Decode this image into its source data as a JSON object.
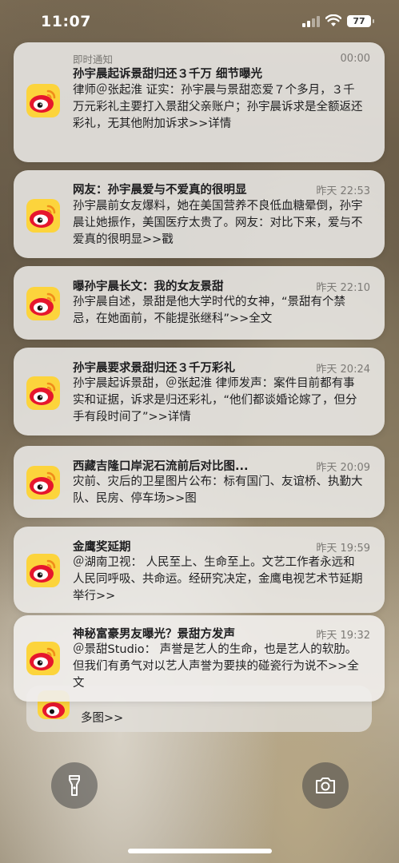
{
  "status_bar": {
    "time": "11:07",
    "battery": "77"
  },
  "instant_label": "即时通知",
  "notifications": [
    {
      "title": "孙宇晨起诉景甜归还３千万 细节曝光",
      "time": "00:00",
      "body": "律师＠张起淮 证实：孙宇晨与景甜恋爱７个多月，３千万元彩礼主要打入景甜父亲账户；孙宇晨诉求是全额返还彩礼，无其他附加诉求>>详情"
    },
    {
      "title": "网友：孙宇晨爱与不爱真的很明显",
      "time": "昨天 22:53",
      "body": "孙宇晨前女友爆料，她在美国营养不良低血糖晕倒，孙宇晨让她振作，美国医疗太贵了。网友：对比下来，爱与不爱真的很明显>>戳"
    },
    {
      "title": "曝孙宇晨长文：我的女友景甜",
      "time": "昨天 22:10",
      "body": "孙宇晨自述，景甜是他大学时代的女神，“景甜有个禁忌，在她面前，不能提张继科”>>全文"
    },
    {
      "title": "孙宇晨要求景甜归还３千万彩礼",
      "time": "昨天 20:24",
      "body": "孙宇晨起诉景甜，＠张起淮 律师发声：案件目前都有事实和证据，诉求是归还彩礼，“他们都谈婚论嫁了，但分手有段时间了”>>详情"
    },
    {
      "title": "西藏吉隆口岸泥石流前后对比图...",
      "time": "昨天 20:09",
      "body": "灾前、灾后的卫星图片公布：标有国门、友谊桥、执勤大队、民房、停车场>>图"
    },
    {
      "title": "金鹰奖延期",
      "time": "昨天 19:59",
      "body": "＠湖南卫视： 人民至上、生命至上。文艺工作者永远和人民同呼吸、共命运。经研究决定，金鹰电视艺术节延期举行>>"
    },
    {
      "title": "神秘富豪男友曝光？景甜方发声",
      "time": "昨天 19:32",
      "body": "＠景甜Studio： 声誉是艺人的生命，也是艺人的软肋。但我们有勇气对以艺人声誉为要挟的碰瓷行为说不>>全文"
    }
  ],
  "stacked_preview": {
    "text": "多图>>"
  },
  "icons": {
    "app": "weibo-icon",
    "left_button": "flashlight-icon",
    "right_button": "camera-icon"
  }
}
